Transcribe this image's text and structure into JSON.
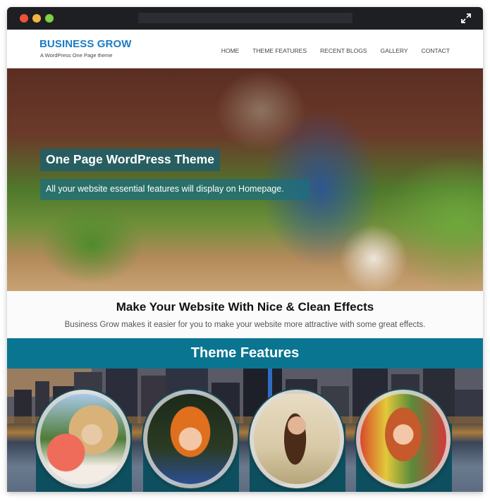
{
  "browser": {
    "traffic_lights": [
      "close",
      "minimize",
      "zoom"
    ],
    "expand_icon": "expand-arrows-icon"
  },
  "header": {
    "logo_title": "BUSINESS GROW",
    "logo_tagline": "A WordPress One Page theme",
    "nav": [
      {
        "label": "HOME"
      },
      {
        "label": "THEME FEATURES"
      },
      {
        "label": "RECENT BLOGS"
      },
      {
        "label": "GALLERY"
      },
      {
        "label": "CONTACT"
      }
    ]
  },
  "hero": {
    "title": "One Page WordPress Theme",
    "subtitle": "All your website essential features will display on Homepage."
  },
  "intro": {
    "title": "Make Your Website With Nice & Clean Effects",
    "text": "Business Grow makes it easier for you to make your website more attractive with some great effects."
  },
  "features": {
    "title": "Theme Features",
    "cards": [
      {
        "image": "portrait-blonde-woman-balloons"
      },
      {
        "image": "portrait-redhead-woman"
      },
      {
        "image": "portrait-brunette-woman"
      },
      {
        "image": "portrait-redhead-girl"
      }
    ]
  },
  "colors": {
    "brand_blue": "#1a7bc4",
    "features_band": "#0a7590",
    "card_teal": "#0d4f5e",
    "chrome_dark": "#1e1f23"
  }
}
